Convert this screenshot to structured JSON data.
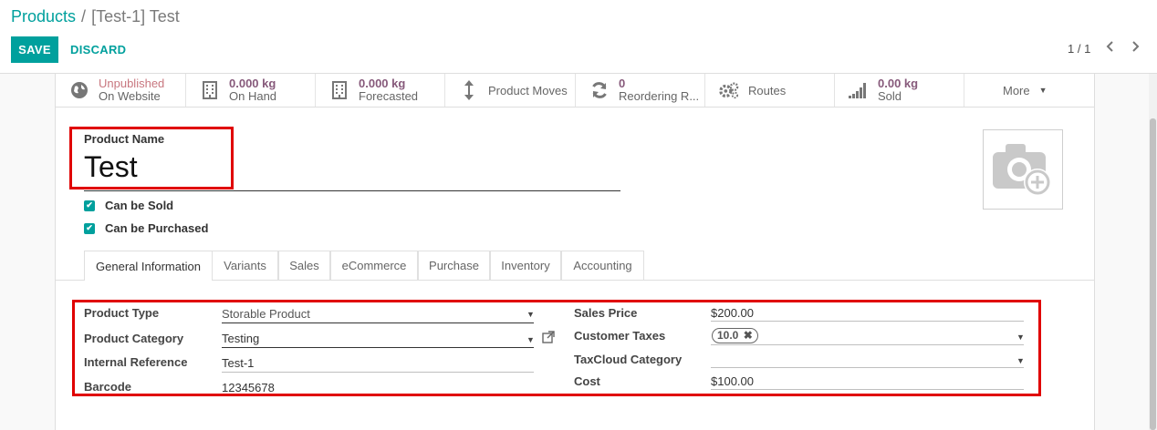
{
  "breadcrumb": {
    "parent": "Products",
    "separator": "/",
    "current": "[Test-1] Test"
  },
  "actions": {
    "save": "SAVE",
    "discard": "DISCARD"
  },
  "pager": {
    "value": "1 / 1",
    "prev": "‹",
    "next": "›"
  },
  "smart_buttons": [
    {
      "icon": "globe-icon",
      "value": "Unpublished",
      "label": "On Website"
    },
    {
      "icon": "building-icon",
      "value": "0.000 kg",
      "label": "On Hand"
    },
    {
      "icon": "building-icon",
      "value": "0.000 kg",
      "label": "Forecasted"
    },
    {
      "icon": "arrows-vertical-icon",
      "label": "Product Moves"
    },
    {
      "icon": "refresh-icon",
      "value": "0",
      "label": "Reordering R..."
    },
    {
      "icon": "cogs-icon",
      "label": "Routes"
    },
    {
      "icon": "signal-icon",
      "value": "0.00 kg",
      "label": "Sold"
    },
    {
      "label": "More"
    }
  ],
  "product": {
    "name_label": "Product Name",
    "name": "Test",
    "can_be_sold": "Can be Sold",
    "can_be_purchased": "Can be Purchased"
  },
  "tabs": [
    "General Information",
    "Variants",
    "Sales",
    "eCommerce",
    "Purchase",
    "Inventory",
    "Accounting"
  ],
  "general": {
    "left": [
      {
        "label": "Product Type",
        "value": "Storable Product"
      },
      {
        "label": "Product Category",
        "value": "Testing"
      },
      {
        "label": "Internal Reference",
        "value": "Test-1"
      },
      {
        "label": "Barcode",
        "value": "12345678"
      }
    ],
    "right": [
      {
        "label": "Sales Price",
        "value": "$200.00"
      },
      {
        "label": "Customer Taxes",
        "value": "10.0"
      },
      {
        "label": "TaxCloud Category",
        "value": ""
      },
      {
        "label": "Cost",
        "value": "$100.00"
      }
    ]
  },
  "colors": {
    "accent": "#00a09d",
    "smart_value": "#875a7b",
    "highlight": "#e00000"
  }
}
